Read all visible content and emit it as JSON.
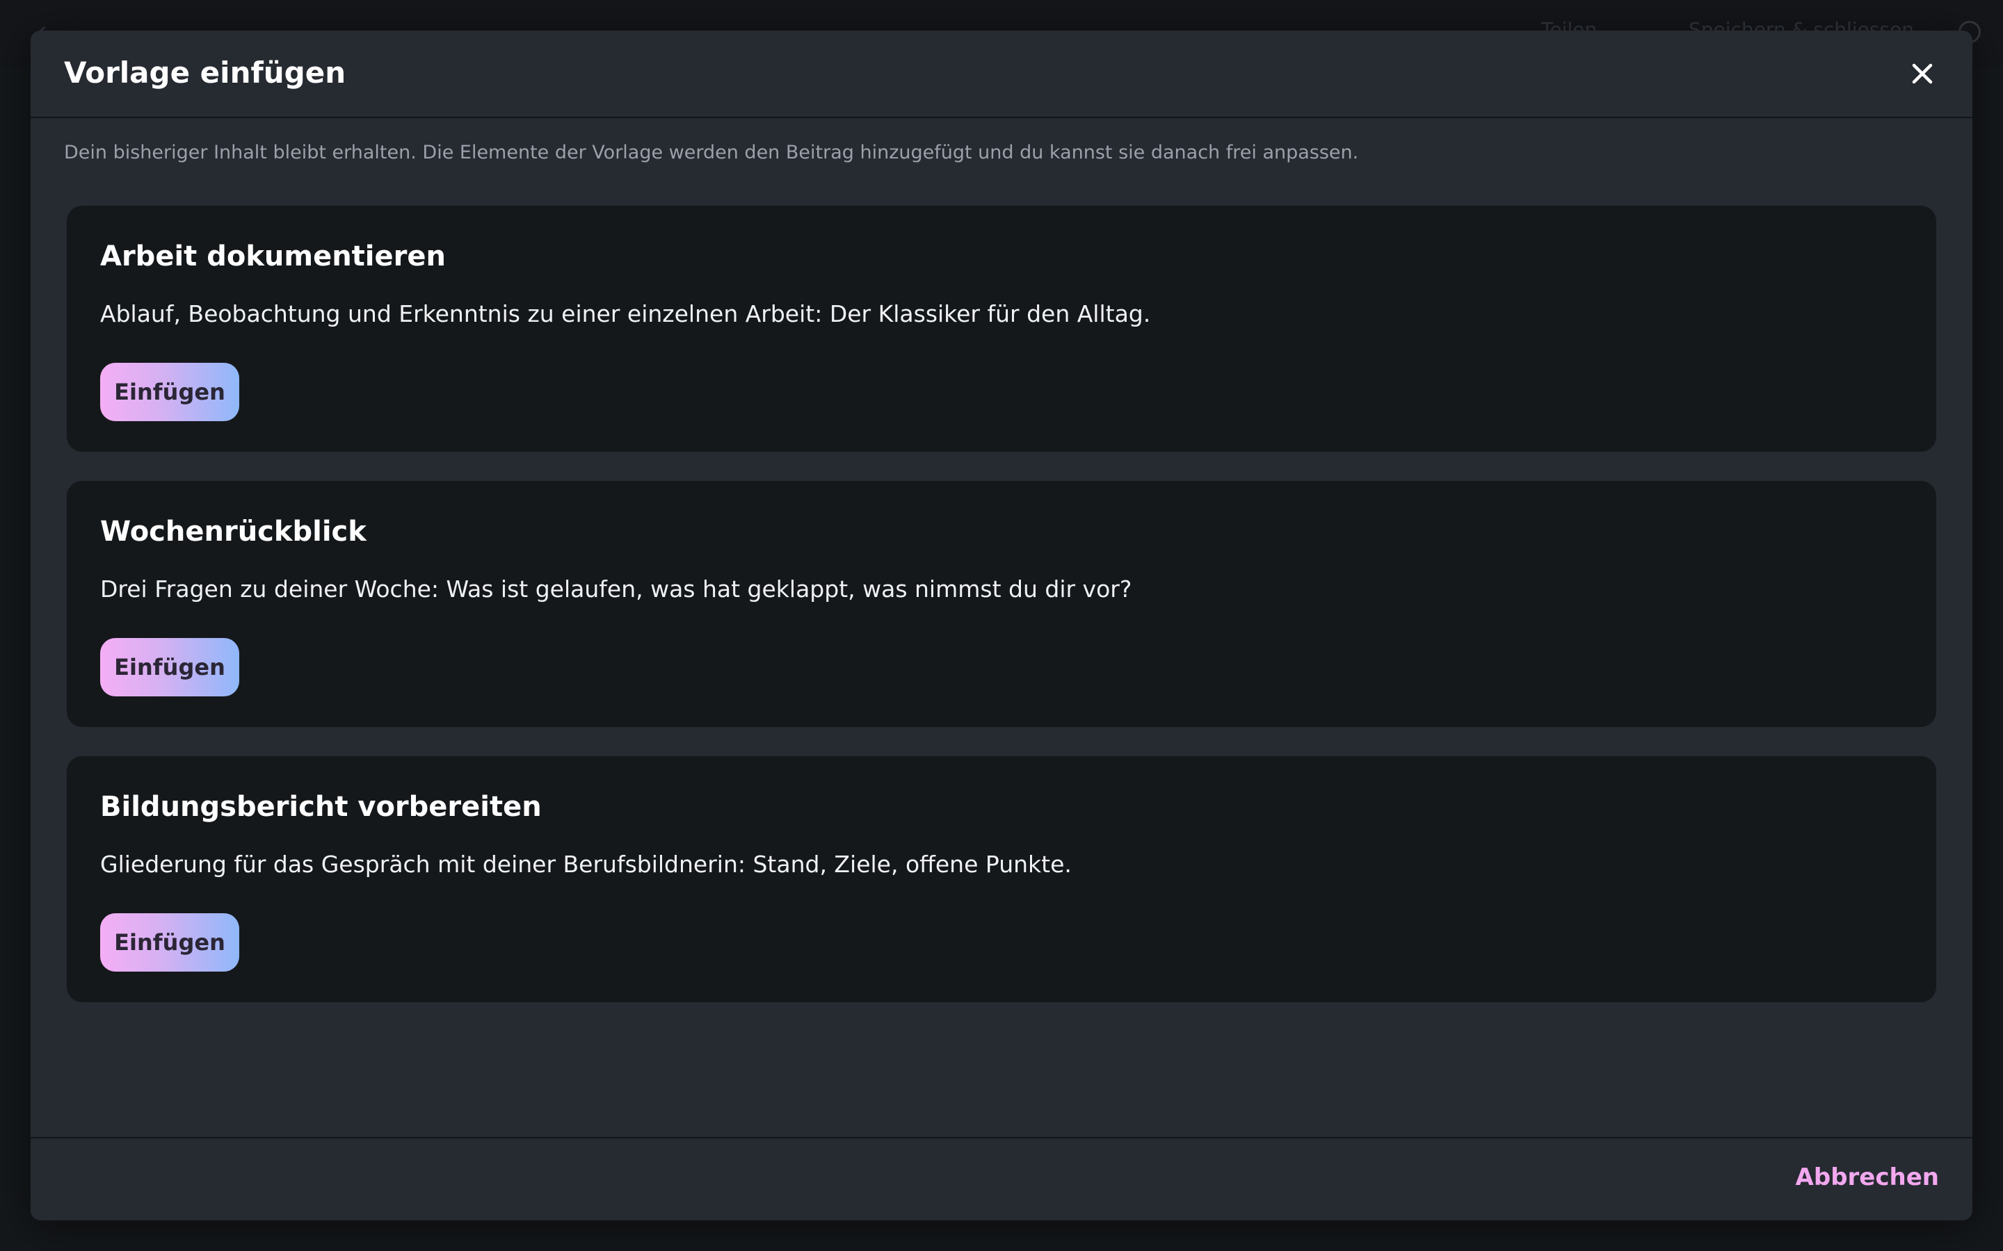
{
  "background": {
    "back_glyph": "‹",
    "share_label": "Teilen",
    "save_close_label": "Speichern & schliessen"
  },
  "modal": {
    "title": "Vorlage einfügen",
    "close_icon": "close-icon",
    "intro": "Dein bisheriger Inhalt bleibt erhalten. Die Elemente der Vorlage werden den Beitrag hinzugefügt und du kannst sie danach frei anpassen.",
    "templates": [
      {
        "title": "Arbeit dokumentieren",
        "description": "Ablauf, Beobachtung und Erkenntnis zu einer einzelnen Arbeit: Der Klassiker für den Alltag.",
        "button_label": "Einfügen"
      },
      {
        "title": "Wochenrückblick",
        "description": "Drei Fragen zu deiner Woche: Was ist gelaufen, was hat geklappt, was nimmst du dir vor?",
        "button_label": "Einfügen"
      },
      {
        "title": "Bildungsbericht vorbereiten",
        "description": "Gliederung für das Gespräch mit deiner Berufsbildnerin: Stand, Ziele, offene Punkte.",
        "button_label": "Einfügen"
      }
    ],
    "cancel_label": "Abbrechen"
  },
  "colors": {
    "modal_bg": "#262a31",
    "card_bg": "#15181b",
    "accent_pink": "#f2a8ef",
    "accent_blue": "#8fb8fa"
  }
}
